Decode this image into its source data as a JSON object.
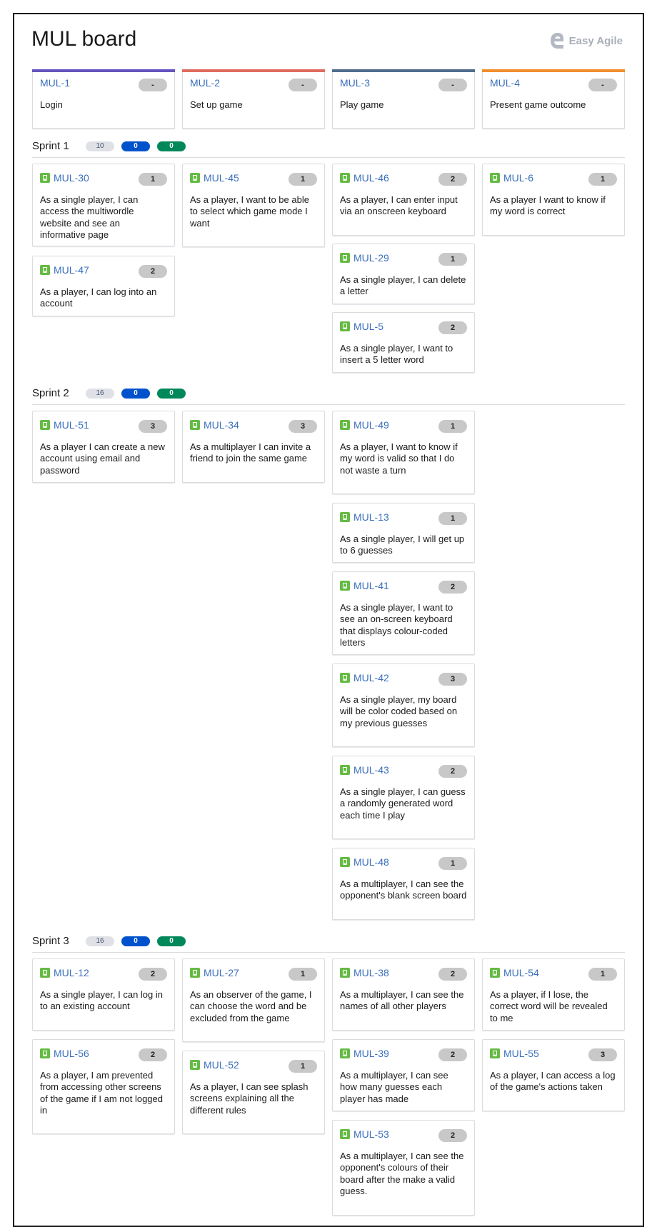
{
  "title": "MUL board",
  "logo": "Easy Agile",
  "epics": [
    {
      "key": "MUL-1",
      "summary": "Login",
      "points": "-",
      "color": "#6554c0"
    },
    {
      "key": "MUL-2",
      "summary": "Set up game",
      "points": "-",
      "color": "#e06c5e"
    },
    {
      "key": "MUL-3",
      "summary": "Play game",
      "points": "-",
      "color": "#4e6c8e"
    },
    {
      "key": "MUL-4",
      "summary": "Present game outcome",
      "points": "-",
      "color": "#f18e2c"
    }
  ],
  "sprints": [
    {
      "name": "Sprint 1",
      "counts": [
        "10",
        "0",
        "0"
      ]
    },
    {
      "name": "Sprint 2",
      "counts": [
        "16",
        "0",
        "0"
      ]
    },
    {
      "name": "Sprint 3",
      "counts": [
        "16",
        "0",
        "0"
      ]
    }
  ],
  "cards": [
    {
      "key": "MUL-30",
      "points": "1",
      "summary": "As a single player, I can access the multiwordle website and see an informative page"
    },
    {
      "key": "MUL-45",
      "points": "1",
      "summary": "As a player, I want to be able to select which game mode I want"
    },
    {
      "key": "MUL-46",
      "points": "2",
      "summary": "As a player, I can enter input via an onscreen keyboard"
    },
    {
      "key": "MUL-6",
      "points": "1",
      "summary": "As a player I want to know if my word is correct"
    },
    {
      "key": "MUL-47",
      "points": "2",
      "summary": "As a player, I can log into an account"
    },
    {
      "key": "MUL-29",
      "points": "1",
      "summary": "As a single player, I can delete a letter"
    },
    {
      "key": "MUL-5",
      "points": "2",
      "summary": "As a single player, I want to insert a 5 letter word"
    },
    {
      "key": "MUL-51",
      "points": "3",
      "summary": "As a player I can create a new account using email and password"
    },
    {
      "key": "MUL-34",
      "points": "3",
      "summary": "As a multiplayer I can invite a friend to join the same game"
    },
    {
      "key": "MUL-49",
      "points": "1",
      "summary": "As a player, I want to know if my word is valid so that I do not waste a turn"
    },
    {
      "key": "MUL-13",
      "points": "1",
      "summary": "As a single player, I will get up to 6 guesses"
    },
    {
      "key": "MUL-41",
      "points": "2",
      "summary": "As a single player, I want to see an on-screen keyboard that displays colour-coded letters"
    },
    {
      "key": "MUL-42",
      "points": "3",
      "summary": "As a single player, my board will be color coded based on my previous guesses"
    },
    {
      "key": "MUL-43",
      "points": "2",
      "summary": "As a single player, I can guess a randomly generated word each time I play"
    },
    {
      "key": "MUL-48",
      "points": "1",
      "summary": "As a multiplayer, I can see the opponent's blank screen board"
    },
    {
      "key": "MUL-12",
      "points": "2",
      "summary": "As a single player, I can log in to an existing account"
    },
    {
      "key": "MUL-27",
      "points": "1",
      "summary": "As an observer of the game, I can choose the word and be excluded from the game"
    },
    {
      "key": "MUL-38",
      "points": "2",
      "summary": "As a multiplayer, I can see the names of all other players"
    },
    {
      "key": "MUL-54",
      "points": "1",
      "summary": "As a player, if I lose, the correct word will be revealed to me"
    },
    {
      "key": "MUL-56",
      "points": "2",
      "summary": "As a player, I am prevented from accessing other screens of the game if I am not logged in"
    },
    {
      "key": "MUL-52",
      "points": "1",
      "summary": "As a player, I can see splash screens explaining all the different rules"
    },
    {
      "key": "MUL-39",
      "points": "2",
      "summary": "As a multiplayer, I can see how many guesses each player has made"
    },
    {
      "key": "MUL-55",
      "points": "3",
      "summary": "As a player, I can access a log of the game's actions taken"
    },
    {
      "key": "MUL-53",
      "points": "2",
      "summary": "As a multiplayer, I can see the opponent's colours of their board after the make a valid guess."
    }
  ]
}
